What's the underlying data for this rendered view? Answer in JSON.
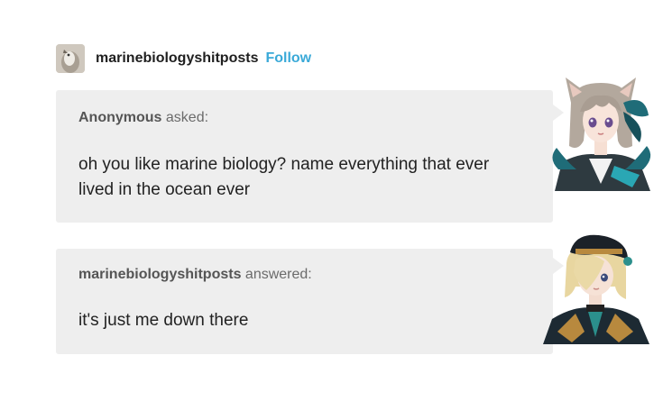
{
  "post": {
    "username": "marinebiologyshitposts",
    "follow_label": "Follow",
    "avatar_icon": "bird-avatar-icon"
  },
  "ask": {
    "asker": "Anonymous",
    "verb": "asked:",
    "message_line1": "oh you like marine biology? name everything that ever",
    "message_line2": "lived in the ocean ever"
  },
  "answer": {
    "answerer": "marinebiologyshitposts",
    "verb": "answered:",
    "message": "it's just me down there"
  },
  "colors": {
    "follow": "#3aa9d8",
    "bubble": "#eeeeee",
    "text": "#222222",
    "meta": "#6b6b6b"
  }
}
